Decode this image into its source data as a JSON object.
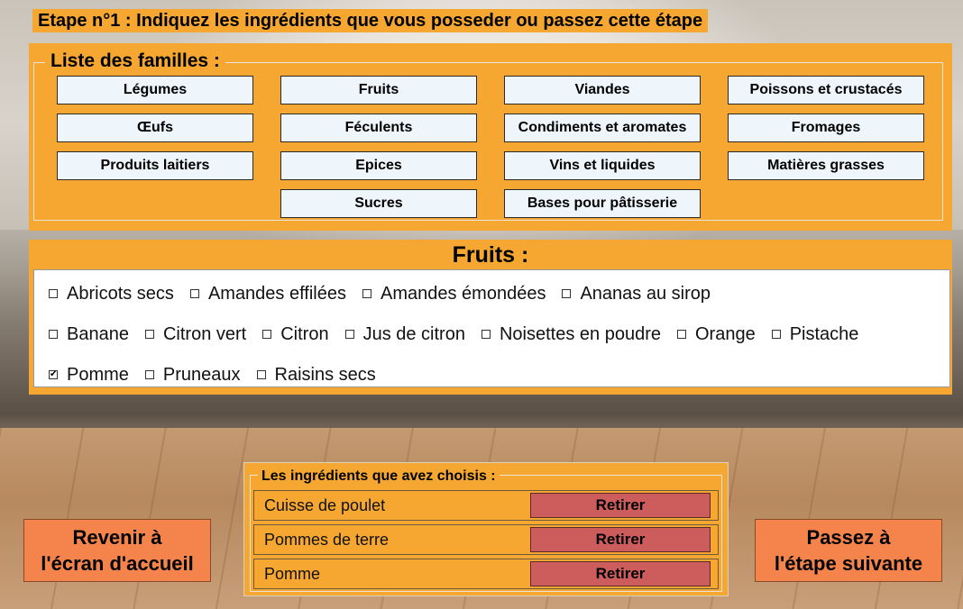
{
  "title": "Etape n°1 : Indiquez les ingrédients que vous posseder ou passez cette étape",
  "families": {
    "legend": "Liste des familles :",
    "buttons": [
      "Légumes",
      "Fruits",
      "Viandes",
      "Poissons et crustacés",
      "Œufs",
      "Féculents",
      "Condiments et aromates",
      "Fromages",
      "Produits laitiers",
      "Epices",
      "Vins et liquides",
      "Matières grasses",
      "Sucres",
      "Bases pour pâtisserie"
    ]
  },
  "fruits": {
    "title": "Fruits :",
    "items": [
      {
        "label": "Abricots secs",
        "checked": false
      },
      {
        "label": "Amandes effilées",
        "checked": false
      },
      {
        "label": "Amandes émondées",
        "checked": false
      },
      {
        "label": "Ananas au sirop",
        "checked": false
      },
      {
        "label": "Banane",
        "checked": false
      },
      {
        "label": "Citron vert",
        "checked": false
      },
      {
        "label": "Citron",
        "checked": false
      },
      {
        "label": "Jus de citron",
        "checked": false
      },
      {
        "label": "Noisettes en poudre",
        "checked": false
      },
      {
        "label": "Orange",
        "checked": false
      },
      {
        "label": "Pistache",
        "checked": false
      },
      {
        "label": "Pomme",
        "checked": true
      },
      {
        "label": "Pruneaux",
        "checked": false
      },
      {
        "label": "Raisins secs",
        "checked": false
      }
    ]
  },
  "chosen": {
    "legend": "Les ingrédients que avez choisis :",
    "items": [
      "Cuisse de poulet",
      "Pommes de terre",
      "Pomme"
    ],
    "remove_label": "Retirer"
  },
  "nav": {
    "back_line1": "Revenir à",
    "back_line2": "l'écran d'accueil",
    "next_line1": "Passez à",
    "next_line2": "l'étape suivante"
  },
  "colors": {
    "panel": "#f5a731",
    "family_button": "#eef5fb",
    "remove_button": "#cd5c5c",
    "nav_button": "#f5844c"
  }
}
